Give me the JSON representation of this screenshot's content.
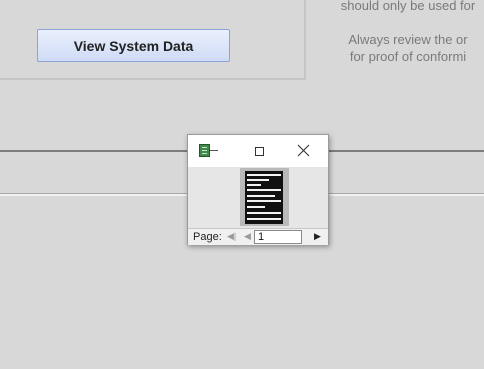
{
  "panel": {
    "view_button_label": "View System Data"
  },
  "info_text": {
    "line1": "should only be used for",
    "line2": "Always review the or",
    "line3": "for proof of conformi"
  },
  "report_window": {
    "icons": {
      "app": "report-book-icon",
      "maximize": "maximize-icon",
      "close": "close-icon",
      "first": "first-page-icon",
      "prev": "previous-page-icon",
      "next": "next-page-icon"
    },
    "status": {
      "page_label": "Page:",
      "page_value": "1"
    }
  }
}
